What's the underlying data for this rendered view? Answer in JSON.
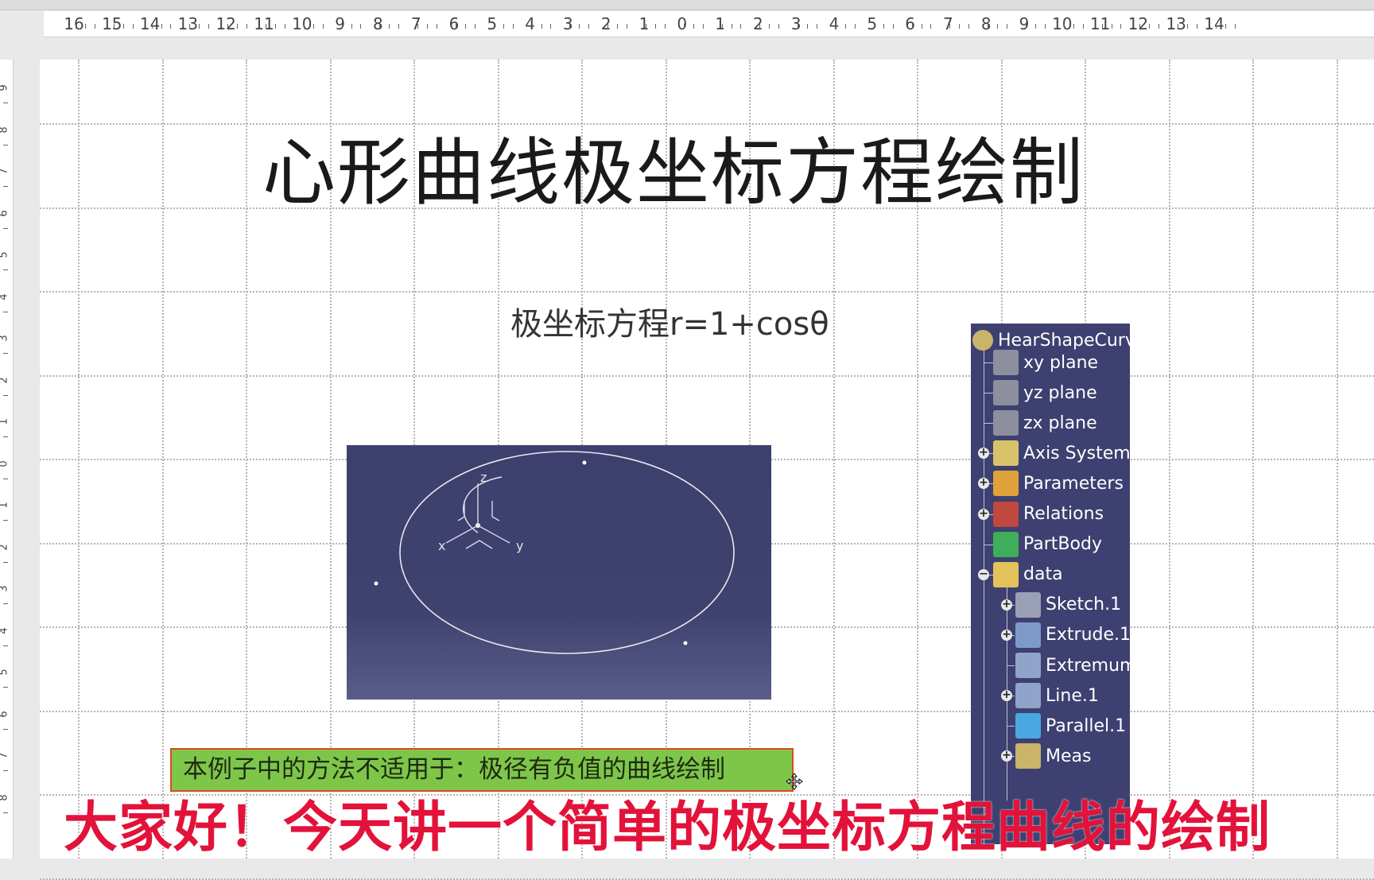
{
  "ruler": {
    "horizontal_labels": [
      "16",
      "15",
      "14",
      "13",
      "12",
      "11",
      "10",
      "9",
      "8",
      "7",
      "6",
      "5",
      "4",
      "3",
      "2",
      "1",
      "0",
      "1",
      "2",
      "3",
      "4",
      "5",
      "6",
      "7",
      "8",
      "9",
      "10",
      "11",
      "12",
      "13",
      "14"
    ],
    "vertical_labels": [
      "9",
      "8",
      "7",
      "6",
      "5",
      "4",
      "3",
      "2",
      "1",
      "0",
      "1",
      "2",
      "3",
      "4",
      "5",
      "6",
      "7",
      "8"
    ]
  },
  "slide": {
    "title": "心形曲线极坐标方程绘制",
    "subtitle": "极坐标方程r=1+cosθ",
    "note": "本例子中的方法不适用于：极径有负值的曲线绘制"
  },
  "viewport": {
    "axis_labels": {
      "z": "z",
      "x": "x",
      "y": "y"
    },
    "background_color": "#3d3f6d"
  },
  "spec_tree": {
    "root": "HearShapeCurv",
    "items": [
      {
        "label": "xy plane",
        "icon": "plane-icon"
      },
      {
        "label": "yz plane",
        "icon": "plane-icon"
      },
      {
        "label": "zx plane",
        "icon": "plane-icon"
      },
      {
        "label": "Axis System",
        "icon": "axis-system-icon"
      },
      {
        "label": "Parameters",
        "icon": "parameters-icon"
      },
      {
        "label": "Relations",
        "icon": "relations-icon"
      },
      {
        "label": "PartBody",
        "icon": "partbody-icon"
      },
      {
        "label": "data",
        "icon": "geometrical-set-icon"
      },
      {
        "label": "Sketch.1",
        "icon": "sketch-icon"
      },
      {
        "label": "Extrude.1",
        "icon": "extrude-icon"
      },
      {
        "label": "Extremum",
        "icon": "extremum-icon"
      },
      {
        "label": "Line.1",
        "icon": "line-icon"
      },
      {
        "label": "Parallel.1",
        "icon": "parallel-icon"
      },
      {
        "label": "Meas",
        "icon": "measure-icon"
      }
    ],
    "background_color": "#3d4070"
  },
  "caption": "大家好！今天讲一个简单的极坐标方程曲线的绘制",
  "colors": {
    "note_bg": "#7ec64a",
    "note_border": "#d84a22",
    "caption": "#e3123a"
  }
}
